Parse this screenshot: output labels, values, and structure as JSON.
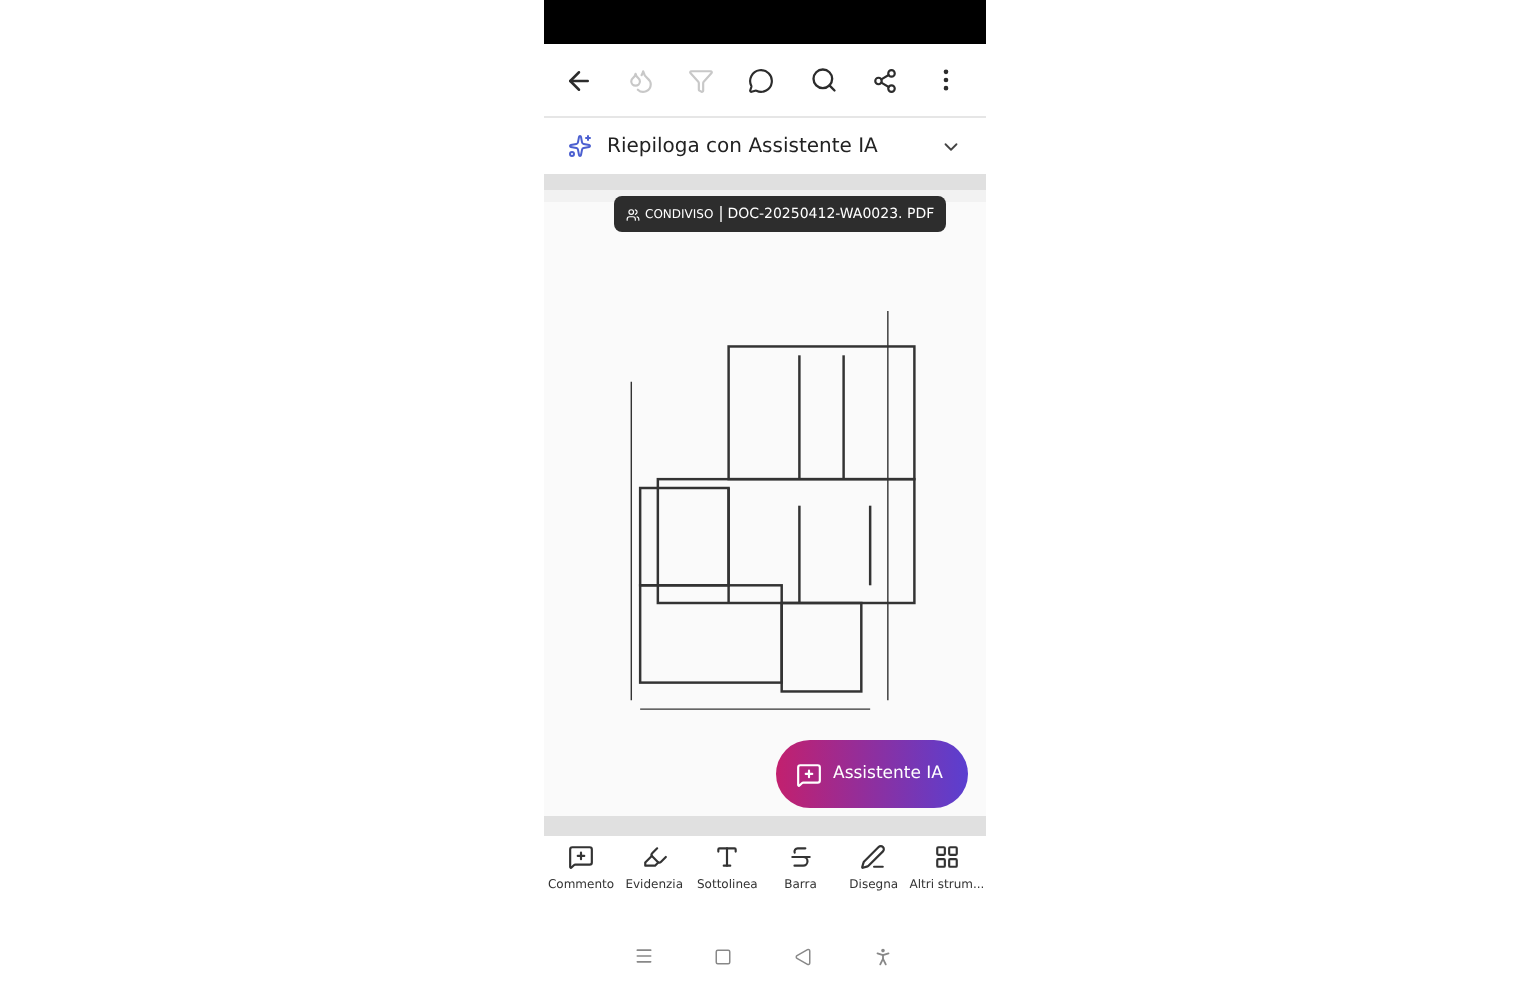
{
  "toolbar": {
    "actions": [
      {
        "kind": "back",
        "disabled": false
      },
      {
        "kind": "fill",
        "disabled": true
      },
      {
        "kind": "filter",
        "disabled": true
      },
      {
        "kind": "comments",
        "disabled": false
      },
      {
        "kind": "search",
        "disabled": false
      },
      {
        "kind": "share",
        "disabled": false
      },
      {
        "kind": "more",
        "disabled": false
      }
    ]
  },
  "summary_bar": {
    "label": "Riepiloga con Assistente IA",
    "expanded": false
  },
  "document": {
    "shared_label": "CONDIVISO",
    "file_name": "DOC-20250412-WA0023. PDF"
  },
  "assistant_button": {
    "label": "Assistente IA"
  },
  "tools": [
    {
      "kind": "comment",
      "label": "Commento"
    },
    {
      "kind": "highlight",
      "label": "Evidenzia"
    },
    {
      "kind": "underline",
      "label": "Sottolinea"
    },
    {
      "kind": "strike",
      "label": "Barra"
    },
    {
      "kind": "draw",
      "label": "Disegna"
    },
    {
      "kind": "more",
      "label": "Altri strum..."
    }
  ]
}
